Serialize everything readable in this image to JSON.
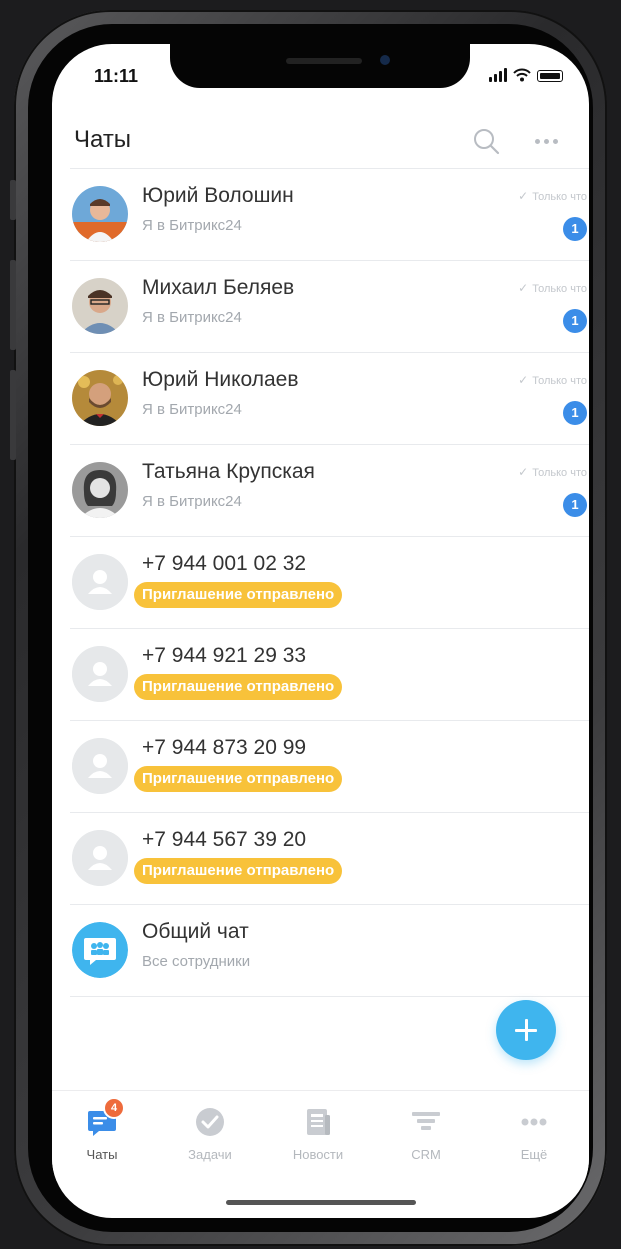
{
  "status_bar": {
    "time": "11:11"
  },
  "header": {
    "title": "Чаты"
  },
  "chats": [
    {
      "name": "Юрий Волошин",
      "subtitle": "Я в Битрикс24",
      "time": "Только что",
      "unread": "1"
    },
    {
      "name": "Михаил Беляев",
      "subtitle": "Я в Битрикс24",
      "time": "Только что",
      "unread": "1"
    },
    {
      "name": "Юрий Николаев",
      "subtitle": "Я в Битрикс24",
      "time": "Только что",
      "unread": "1"
    },
    {
      "name": "Татьяна Крупская",
      "subtitle": "Я в Битрикс24",
      "time": "Только что",
      "unread": "1"
    }
  ],
  "invites": [
    {
      "phone": "+7 944 001 02 32",
      "status": "Приглашение отправлено"
    },
    {
      "phone": "+7 944 921 29 33",
      "status": "Приглашение отправлено"
    },
    {
      "phone": "+7 944 873 20 99",
      "status": "Приглашение отправлено"
    },
    {
      "phone": "+7 944 567 39 20",
      "status": "Приглашение отправлено"
    }
  ],
  "group_chat": {
    "name": "Общий чат",
    "subtitle": "Все сотрудники"
  },
  "tabs": [
    {
      "label": "Чаты",
      "badge": "4",
      "icon": "chat-icon"
    },
    {
      "label": "Задачи",
      "icon": "tasks-check-icon"
    },
    {
      "label": "Новости",
      "icon": "news-icon"
    },
    {
      "label": "CRM",
      "icon": "crm-funnel-icon"
    },
    {
      "label": "Ещё",
      "icon": "more-dots-icon"
    }
  ],
  "colors": {
    "accent": "#3b8de8",
    "fab": "#3fb5ee",
    "invite_badge": "#f8c23a",
    "tab_badge": "#ee6b3c"
  }
}
